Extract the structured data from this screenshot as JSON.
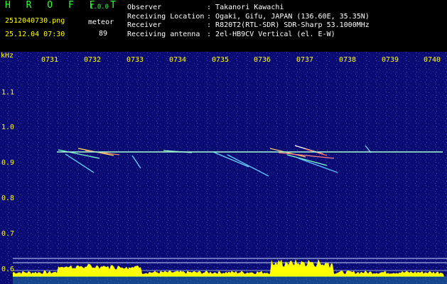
{
  "header": {
    "app_title": "H R O F F T",
    "version": "1.0.0",
    "filename": "2512040730.png",
    "datetime": "25.12.04 07:30",
    "type_label": "meteor",
    "count": "89",
    "info": [
      {
        "label": "Observer",
        "value": "Takanori Kawachi"
      },
      {
        "label": "Receiving Location",
        "value": "Ogaki, Gifu, JAPAN (136.60E, 35.35N)"
      },
      {
        "label": "Receiver",
        "value": "R820T2(RTL-SDR) SDR-Sharp 53.1000MHz"
      },
      {
        "label": "Receiving antenna",
        "value": "2el-HB9CV Vertical (el. E-W)"
      }
    ]
  },
  "spectrogram": {
    "y_unit": "kHz",
    "y_ticks": [
      "1.1",
      "1.0",
      "0.9",
      "0.8",
      "0.7",
      "0.6"
    ],
    "x_ticks": [
      "0731",
      "0732",
      "0733",
      "0734",
      "0735",
      "0736",
      "0737",
      "0738",
      "0739",
      "0740"
    ],
    "colors": {
      "background": "#0a0a6e",
      "label": "#ffff00",
      "carrier": "#a8ffd0",
      "activity": "#ffff00",
      "baseline": "#33c8ff"
    }
  }
}
